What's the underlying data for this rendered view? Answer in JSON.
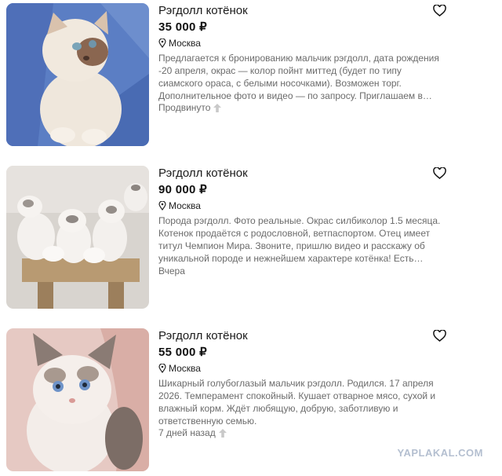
{
  "listings": [
    {
      "title": "Рэгдолл котёнок",
      "price": "35 000 ₽",
      "location": "Москва",
      "description": "Предлагается к бронированию мальчик рэгдолл, дата рождения -20 апреля, окрас — колор пойнт миттед (будет по типу сиамского ораса, с белыми носочками). Возможен торг. Дополнительное фото и видео — по запросу. Приглашаем в…",
      "meta": "Продвинуто",
      "meta_icon": "up-arrow-icon"
    },
    {
      "title": "Рэгдолл котёнок",
      "price": "90 000 ₽",
      "location": "Москва",
      "description": "Порода рэгдолл. Фото реальные. Окрас силбиколор 1.5 месяца. Котенок продаётся с родословной, ветпаспортом. Отец имеет титул Чемпион Мира. Звоните, пришлю видео и расскажу об уникальной породе и нежнейшем характере котёнка! Есть…",
      "meta": "Вчера"
    },
    {
      "title": "Рэгдолл котёнок",
      "price": "55 000 ₽",
      "location": "Москва",
      "description": "Шикарный голубоглазый мальчик рэгдолл. Родился. 17 апреля 2026. Темперамент спокойный. Кушает отварное мясо, сухой и влажный корм. Ждёт любящую, добрую, заботливую и ответственную семью.",
      "meta": "7 дней назад",
      "meta_icon": "up-arrow-icon"
    }
  ],
  "icons": {
    "favorite": "heart-icon",
    "location": "map-pin-icon"
  },
  "watermark": "YAPLAKAL.COM"
}
